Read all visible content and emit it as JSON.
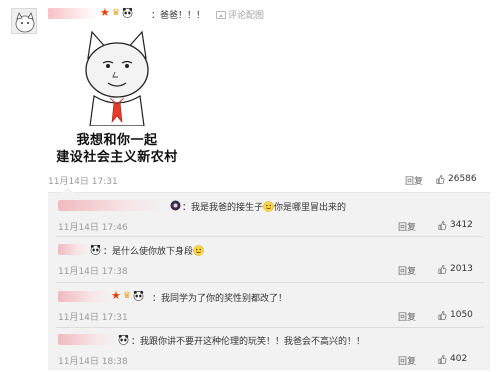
{
  "main_comment": {
    "text": "：爸爸！！！",
    "tool_label": "评论配图",
    "meme_caption_line1": "我想和你一起",
    "meme_caption_line2": "建设社会主义新农村",
    "time": "11月14日 17:31",
    "reply_label": "回复",
    "likes": "26586"
  },
  "replies": [
    {
      "text_a": "：我是我爸的接生子",
      "text_b": "你是哪里冒出来的",
      "time": "11月14日 17:46",
      "reply_label": "回复",
      "likes": "3412"
    },
    {
      "text_a": "：是什么使你放下身段",
      "time": "11月14日 17:38",
      "reply_label": "回复",
      "likes": "2013"
    },
    {
      "text_a": "：我同学为了你的奖性别都改了！",
      "time": "11月14日 17:31",
      "reply_label": "回复",
      "likes": "1050"
    },
    {
      "text_a": "：我跟你讲不要开这种伦理的玩笑！！我爸会不高兴的！！",
      "time": "11月14日 18:38",
      "reply_label": "回复",
      "likes": "402"
    }
  ],
  "icons": {
    "star": "star-icon",
    "crown": "vip-crown-icon",
    "panda": "panda-icon",
    "image": "image-icon",
    "thumb": "thumbs-up-icon"
  },
  "colors": {
    "star": "#e8400c",
    "crown": "#e8a11f",
    "link_gray": "#a5a5a5",
    "reply_bg": "#f2f2f2"
  }
}
